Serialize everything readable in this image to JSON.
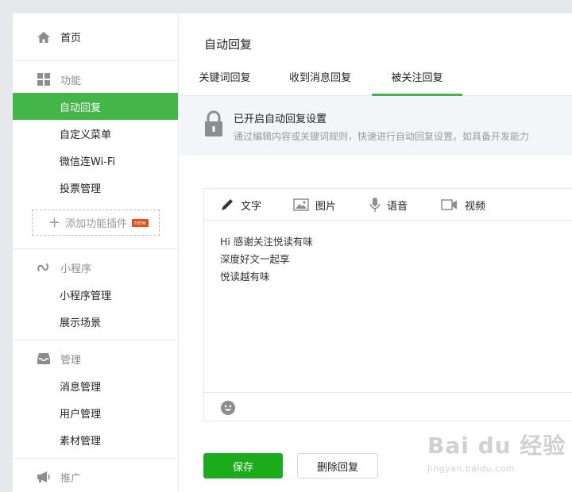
{
  "sidebar": {
    "home": "首页",
    "groups": {
      "features": {
        "title": "功能",
        "items": [
          "自动回复",
          "自定义菜单",
          "微信连Wi-Fi",
          "投票管理"
        ],
        "add_plugin": "添加功能插件",
        "badge": "new"
      },
      "miniprogram": {
        "title": "小程序",
        "items": [
          "小程序管理",
          "展示场景"
        ]
      },
      "manage": {
        "title": "管理",
        "items": [
          "消息管理",
          "用户管理",
          "素材管理"
        ]
      },
      "promote": {
        "title": "推广"
      }
    }
  },
  "main": {
    "title": "自动回复",
    "tabs": [
      "关键词回复",
      "收到消息回复",
      "被关注回复"
    ],
    "active_tab": "被关注回复",
    "notice": {
      "title": "已开启自动回复设置",
      "desc": "通过编辑内容或关键词规则，快速进行自动回复设置。如具备开发能力"
    },
    "editor": {
      "tools": [
        "文字",
        "图片",
        "语音",
        "视频"
      ],
      "lines": [
        "Hi 感谢关注悦读有味",
        "深度好文一起享",
        "悦读越有味"
      ]
    },
    "buttons": {
      "save": "保存",
      "delete": "删除回复"
    }
  },
  "watermark": {
    "main": "Bai du 经验",
    "sub": "jingyan.baidu.com"
  },
  "colors": {
    "accent": "#44b549",
    "save": "#1aad19"
  }
}
